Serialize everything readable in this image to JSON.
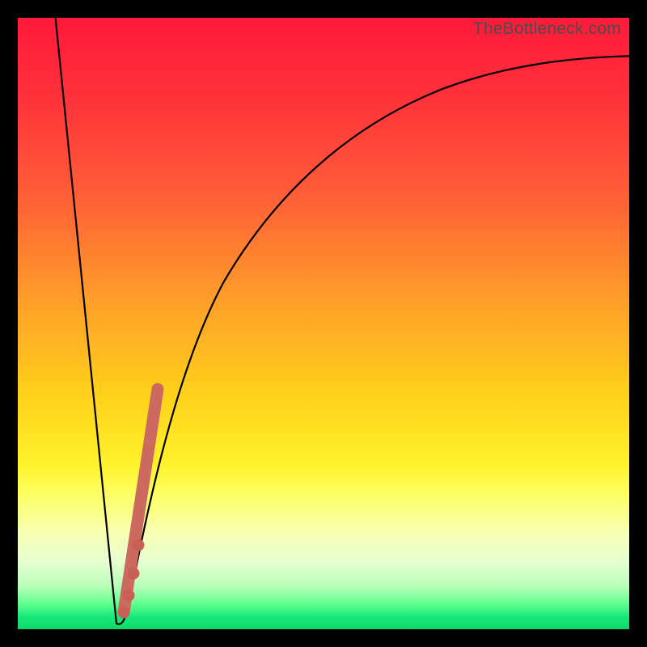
{
  "watermark": "TheBottleneck.com",
  "colors": {
    "curve": "#000000",
    "marker": "#cd6a60",
    "marker_dot": "#c96058"
  },
  "chart_data": {
    "type": "line",
    "title": "",
    "xlabel": "",
    "ylabel": "",
    "xlim": [
      0,
      100
    ],
    "ylim": [
      0,
      100
    ],
    "grid": false,
    "legend": false,
    "background": "rainbow-gradient-red-to-green",
    "series": [
      {
        "name": "bottleneck-curve-left",
        "type": "line",
        "x": [
          6,
          7,
          8,
          9,
          10,
          11,
          12,
          13,
          14,
          15,
          16
        ],
        "y": [
          100,
          90.5,
          81,
          71.5,
          62,
          52,
          42,
          31,
          20,
          9,
          1
        ]
      },
      {
        "name": "bottleneck-curve-right",
        "type": "line",
        "x": [
          16,
          17,
          18,
          19,
          20,
          21,
          22,
          23,
          24,
          26,
          28,
          30,
          33,
          36,
          40,
          45,
          50,
          56,
          63,
          72,
          82,
          92,
          100
        ],
        "y": [
          1,
          3,
          8,
          15,
          22,
          29,
          35,
          40,
          45,
          52,
          58,
          63,
          68,
          72,
          76,
          80,
          83,
          85.5,
          87.8,
          89.5,
          91,
          92,
          92.7
        ]
      },
      {
        "name": "marker-segment",
        "type": "line",
        "x": [
          17.3,
          22.8
        ],
        "y": [
          2.5,
          39
        ]
      },
      {
        "name": "marker-dots",
        "type": "scatter",
        "x": [
          17.3,
          18.0,
          18.9,
          19.7
        ],
        "y": [
          2.5,
          5.3,
          9.0,
          13.3
        ]
      }
    ],
    "annotations": [
      {
        "text": "TheBottleneck.com",
        "position": "top-right"
      }
    ]
  }
}
